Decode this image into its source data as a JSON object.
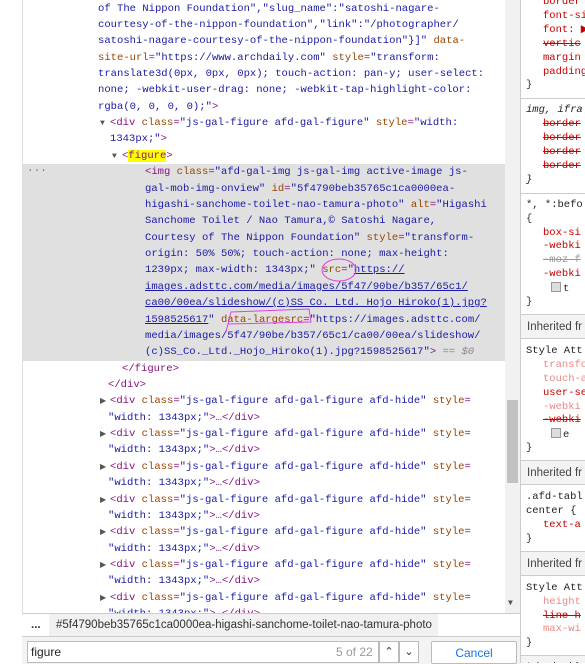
{
  "dom_lines": [
    {
      "depth": 0,
      "tokens": [
        [
          "val",
          "of The Nippon Foundation\",\"slug_name\":\"satoshi-nagare-"
        ]
      ]
    },
    {
      "depth": 0,
      "tokens": [
        [
          "val",
          "courtesy-of-the-nippon-foundation\",\"link\":\"/photographer/"
        ]
      ]
    },
    {
      "depth": 0,
      "tokens": [
        [
          "val",
          "satoshi-nagare-courtesy-of-the-nippon-foundation\"}]\""
        ],
        [
          "attr",
          " data-"
        ]
      ]
    },
    {
      "depth": 0,
      "tokens": [
        [
          "attr",
          "site-url"
        ],
        [
          "tag",
          "="
        ],
        [
          "val",
          "\"https://www.archdaily.com\""
        ],
        [
          "attr",
          " style"
        ],
        [
          "tag",
          "="
        ],
        [
          "val",
          "\"transform:"
        ]
      ]
    },
    {
      "depth": 0,
      "tokens": [
        [
          "val",
          "translate3d(0px, 0px, 0px); touch-action: pan-y; user-select:"
        ]
      ]
    },
    {
      "depth": 0,
      "tokens": [
        [
          "val",
          "none; -webkit-user-drag: none; -webkit-tap-highlight-color:"
        ]
      ]
    },
    {
      "depth": 0,
      "tokens": [
        [
          "val",
          "rgba(0, 0, 0, 0);\""
        ],
        [
          "tag",
          ">"
        ]
      ]
    },
    {
      "depth": 1,
      "arrow": "open",
      "tokens": [
        [
          "tag",
          "<div"
        ],
        [
          "attr",
          " class"
        ],
        [
          "tag",
          "="
        ],
        [
          "val",
          "\"js-gal-figure afd-gal-figure\""
        ],
        [
          "attr",
          " style"
        ],
        [
          "tag",
          "="
        ],
        [
          "val",
          "\"width:"
        ]
      ]
    },
    {
      "depth": 1,
      "tokens": [
        [
          "val",
          "1343px;\""
        ],
        [
          "tag",
          ">"
        ]
      ]
    },
    {
      "depth": 2,
      "arrow": "open",
      "tokens": [
        [
          "tag",
          "<"
        ],
        [
          "hl",
          "figure"
        ],
        [
          "tag",
          ">"
        ]
      ]
    },
    {
      "depth": 3,
      "selected": true,
      "dots": "...",
      "tokens": [
        [
          "tag",
          "<img"
        ],
        [
          "attr",
          " class"
        ],
        [
          "tag",
          "="
        ],
        [
          "val",
          "\"afd-gal-img js-gal-img active-image js-"
        ]
      ]
    },
    {
      "depth": 3,
      "selected": true,
      "tokens": [
        [
          "val",
          "gal-mob-img-onview\""
        ],
        [
          "attr",
          " id"
        ],
        [
          "tag",
          "="
        ],
        [
          "val",
          "\"5f4790beb35765c1ca0000ea-"
        ]
      ]
    },
    {
      "depth": 3,
      "selected": true,
      "tokens": [
        [
          "val",
          "higashi-sanchome-toilet-nao-tamura-photo\""
        ],
        [
          "attr",
          " alt"
        ],
        [
          "tag",
          "="
        ],
        [
          "val",
          "\"Higashi"
        ]
      ]
    },
    {
      "depth": 3,
      "selected": true,
      "tokens": [
        [
          "val",
          "Sanchome Toilet / Nao Tamura,© Satoshi Nagare,"
        ]
      ]
    },
    {
      "depth": 3,
      "selected": true,
      "tokens": [
        [
          "val",
          "Courtesy of The Nippon Foundation\""
        ],
        [
          "attr",
          " style"
        ],
        [
          "tag",
          "="
        ],
        [
          "val",
          "\"transform-"
        ]
      ]
    },
    {
      "depth": 3,
      "selected": true,
      "tokens": [
        [
          "val",
          "origin: 50% 50%; touch-action: none; max-height:"
        ]
      ]
    },
    {
      "depth": 3,
      "selected": true,
      "tokens": [
        [
          "val",
          "1239px; max-width: 1343px;\""
        ],
        [
          "attr",
          " src"
        ],
        [
          "tag",
          "="
        ],
        [
          "val",
          "\""
        ],
        [
          "link",
          "https://"
        ]
      ]
    },
    {
      "depth": 3,
      "selected": true,
      "tokens": [
        [
          "link",
          "images.adsttc.com/media/images/5f47/90be/b357/65c1/"
        ]
      ]
    },
    {
      "depth": 3,
      "selected": true,
      "tokens": [
        [
          "link",
          "ca00/00ea/slideshow/(c)SS Co. Ltd. Hojo Hiroko(1).jpg?"
        ]
      ]
    },
    {
      "depth": 3,
      "selected": true,
      "tokens": [
        [
          "link",
          "1598525617"
        ],
        [
          "val",
          "\""
        ],
        [
          "attr",
          " data-largesrc"
        ],
        [
          "tag",
          "="
        ],
        [
          "val",
          "\"https://images.adsttc.com/"
        ]
      ]
    },
    {
      "depth": 3,
      "selected": true,
      "tokens": [
        [
          "val",
          "media/images/5f47/90be/b357/65c1/ca00/00ea/slideshow/"
        ]
      ]
    },
    {
      "depth": 3,
      "selected": true,
      "tokens": [
        [
          "val",
          "(c)SS_Co._Ltd._Hojo_Hiroko(1).jpg?1598525617\""
        ],
        [
          "tag",
          ">"
        ],
        [
          "gray",
          " == $0"
        ]
      ]
    },
    {
      "depth": 2,
      "tokens": [
        [
          "tag",
          "</figure>"
        ]
      ]
    },
    {
      "depth": 1,
      "tokens": [
        [
          "tag",
          "</div>"
        ]
      ]
    },
    {
      "depth": 1,
      "arrow": "closed",
      "tokens": [
        [
          "tag",
          "<div"
        ],
        [
          "attr",
          " class"
        ],
        [
          "tag",
          "="
        ],
        [
          "val",
          "\"js-gal-figure afd-gal-figure afd-hide\""
        ],
        [
          "attr",
          " style"
        ],
        [
          "tag",
          "="
        ]
      ]
    },
    {
      "depth": 1,
      "tokens": [
        [
          "val",
          "\"width: 1343px;\""
        ],
        [
          "tag",
          ">…</div>"
        ]
      ]
    },
    {
      "depth": 1,
      "arrow": "closed",
      "tokens": [
        [
          "tag",
          "<div"
        ],
        [
          "attr",
          " class"
        ],
        [
          "tag",
          "="
        ],
        [
          "val",
          "\"js-gal-figure afd-gal-figure afd-hide\""
        ],
        [
          "attr",
          " style"
        ],
        [
          "tag",
          "="
        ]
      ]
    },
    {
      "depth": 1,
      "tokens": [
        [
          "val",
          "\"width: 1343px;\""
        ],
        [
          "tag",
          ">…</div>"
        ]
      ]
    },
    {
      "depth": 1,
      "arrow": "closed",
      "tokens": [
        [
          "tag",
          "<div"
        ],
        [
          "attr",
          " class"
        ],
        [
          "tag",
          "="
        ],
        [
          "val",
          "\"js-gal-figure afd-gal-figure afd-hide\""
        ],
        [
          "attr",
          " style"
        ],
        [
          "tag",
          "="
        ]
      ]
    },
    {
      "depth": 1,
      "tokens": [
        [
          "val",
          "\"width: 1343px;\""
        ],
        [
          "tag",
          ">…</div>"
        ]
      ]
    },
    {
      "depth": 1,
      "arrow": "closed",
      "tokens": [
        [
          "tag",
          "<div"
        ],
        [
          "attr",
          " class"
        ],
        [
          "tag",
          "="
        ],
        [
          "val",
          "\"js-gal-figure afd-gal-figure afd-hide\""
        ],
        [
          "attr",
          " style"
        ],
        [
          "tag",
          "="
        ]
      ]
    },
    {
      "depth": 1,
      "tokens": [
        [
          "val",
          "\"width: 1343px;\""
        ],
        [
          "tag",
          ">…</div>"
        ]
      ]
    },
    {
      "depth": 1,
      "arrow": "closed",
      "tokens": [
        [
          "tag",
          "<div"
        ],
        [
          "attr",
          " class"
        ],
        [
          "tag",
          "="
        ],
        [
          "val",
          "\"js-gal-figure afd-gal-figure afd-hide\""
        ],
        [
          "attr",
          " style"
        ],
        [
          "tag",
          "="
        ]
      ]
    },
    {
      "depth": 1,
      "tokens": [
        [
          "val",
          "\"width: 1343px;\""
        ],
        [
          "tag",
          ">…</div>"
        ]
      ]
    },
    {
      "depth": 1,
      "arrow": "closed",
      "tokens": [
        [
          "tag",
          "<div"
        ],
        [
          "attr",
          " class"
        ],
        [
          "tag",
          "="
        ],
        [
          "val",
          "\"js-gal-figure afd-gal-figure afd-hide\""
        ],
        [
          "attr",
          " style"
        ],
        [
          "tag",
          "="
        ]
      ]
    },
    {
      "depth": 1,
      "tokens": [
        [
          "val",
          "\"width: 1343px;\""
        ],
        [
          "tag",
          ">…</div>"
        ]
      ]
    },
    {
      "depth": 1,
      "arrow": "closed",
      "tokens": [
        [
          "tag",
          "<div"
        ],
        [
          "attr",
          " class"
        ],
        [
          "tag",
          "="
        ],
        [
          "val",
          "\"js-gal-figure afd-gal-figure afd-hide\""
        ],
        [
          "attr",
          " style"
        ],
        [
          "tag",
          "="
        ]
      ]
    },
    {
      "depth": 1,
      "tokens": [
        [
          "val",
          "\"width: 1343px;\""
        ],
        [
          "tag",
          ">…</div>"
        ]
      ]
    }
  ],
  "styles_pane": [
    {
      "kind": "prop",
      "text": "border"
    },
    {
      "kind": "prop",
      "text": "font-si"
    },
    {
      "kind": "prop",
      "text": "font: ▶"
    },
    {
      "kind": "strike",
      "text": "vertic"
    },
    {
      "kind": "prop",
      "text": "margin"
    },
    {
      "kind": "prop",
      "text": "padding"
    },
    {
      "kind": "brace",
      "text": "}"
    },
    {
      "kind": "divider"
    },
    {
      "kind": "ital",
      "text": "img, ifra"
    },
    {
      "kind": "strike",
      "text": "border"
    },
    {
      "kind": "strike",
      "text": "border"
    },
    {
      "kind": "strike",
      "text": "border"
    },
    {
      "kind": "strike",
      "text": "border"
    },
    {
      "kind": "ital",
      "text": "}"
    },
    {
      "kind": "divider"
    },
    {
      "kind": "sel",
      "text": "*, *:befo"
    },
    {
      "kind": "brace",
      "text": "{"
    },
    {
      "kind": "prop",
      "text": "box-si"
    },
    {
      "kind": "prop",
      "text": "-webki"
    },
    {
      "kind": "strikeg",
      "text": "-moz f"
    },
    {
      "kind": "prop",
      "text": "-webki"
    },
    {
      "kind": "chk",
      "text": "t"
    },
    {
      "kind": "brace",
      "text": "}"
    },
    {
      "kind": "inherited",
      "text": "Inherited fr"
    },
    {
      "kind": "sel",
      "text": "Style Att"
    },
    {
      "kind": "light",
      "text": "transfo"
    },
    {
      "kind": "light",
      "text": "touch-a"
    },
    {
      "kind": "prop",
      "text": "user-se"
    },
    {
      "kind": "light",
      "text": "-webki"
    },
    {
      "kind": "strike",
      "text": "-webki"
    },
    {
      "kind": "chk",
      "text": "e"
    },
    {
      "kind": "brace",
      "text": "}"
    },
    {
      "kind": "inherited",
      "text": "Inherited fr"
    },
    {
      "kind": "sel",
      "text": ".afd-tabl"
    },
    {
      "kind": "sel",
      "text": "center {"
    },
    {
      "kind": "prop",
      "text": "text-a"
    },
    {
      "kind": "brace",
      "text": "}"
    },
    {
      "kind": "inherited",
      "text": "Inherited fr"
    },
    {
      "kind": "sel",
      "text": "Style Att"
    },
    {
      "kind": "light",
      "text": "height"
    },
    {
      "kind": "strike",
      "text": "line h"
    },
    {
      "kind": "light",
      "text": "max-wi"
    },
    {
      "kind": "brace",
      "text": "}"
    },
    {
      "kind": "inherited",
      "text": "Inherited fr"
    }
  ],
  "breadcrumb": {
    "more": "...",
    "item": "#5f4790beb35765c1ca0000ea-higashi-sanchome-toilet-nao-tamura-photo"
  },
  "search": {
    "value": "figure",
    "match_count": "5 of 22",
    "prev_icon": "chevron-up-icon",
    "next_icon": "chevron-down-icon",
    "cancel_label": "Cancel"
  },
  "colors": {
    "tag": "#881280",
    "attr": "#994500",
    "value": "#1a1aa6",
    "highlight": "#ffff00",
    "selected_row": "#e0e0e0",
    "annotation": "#e040e0"
  }
}
